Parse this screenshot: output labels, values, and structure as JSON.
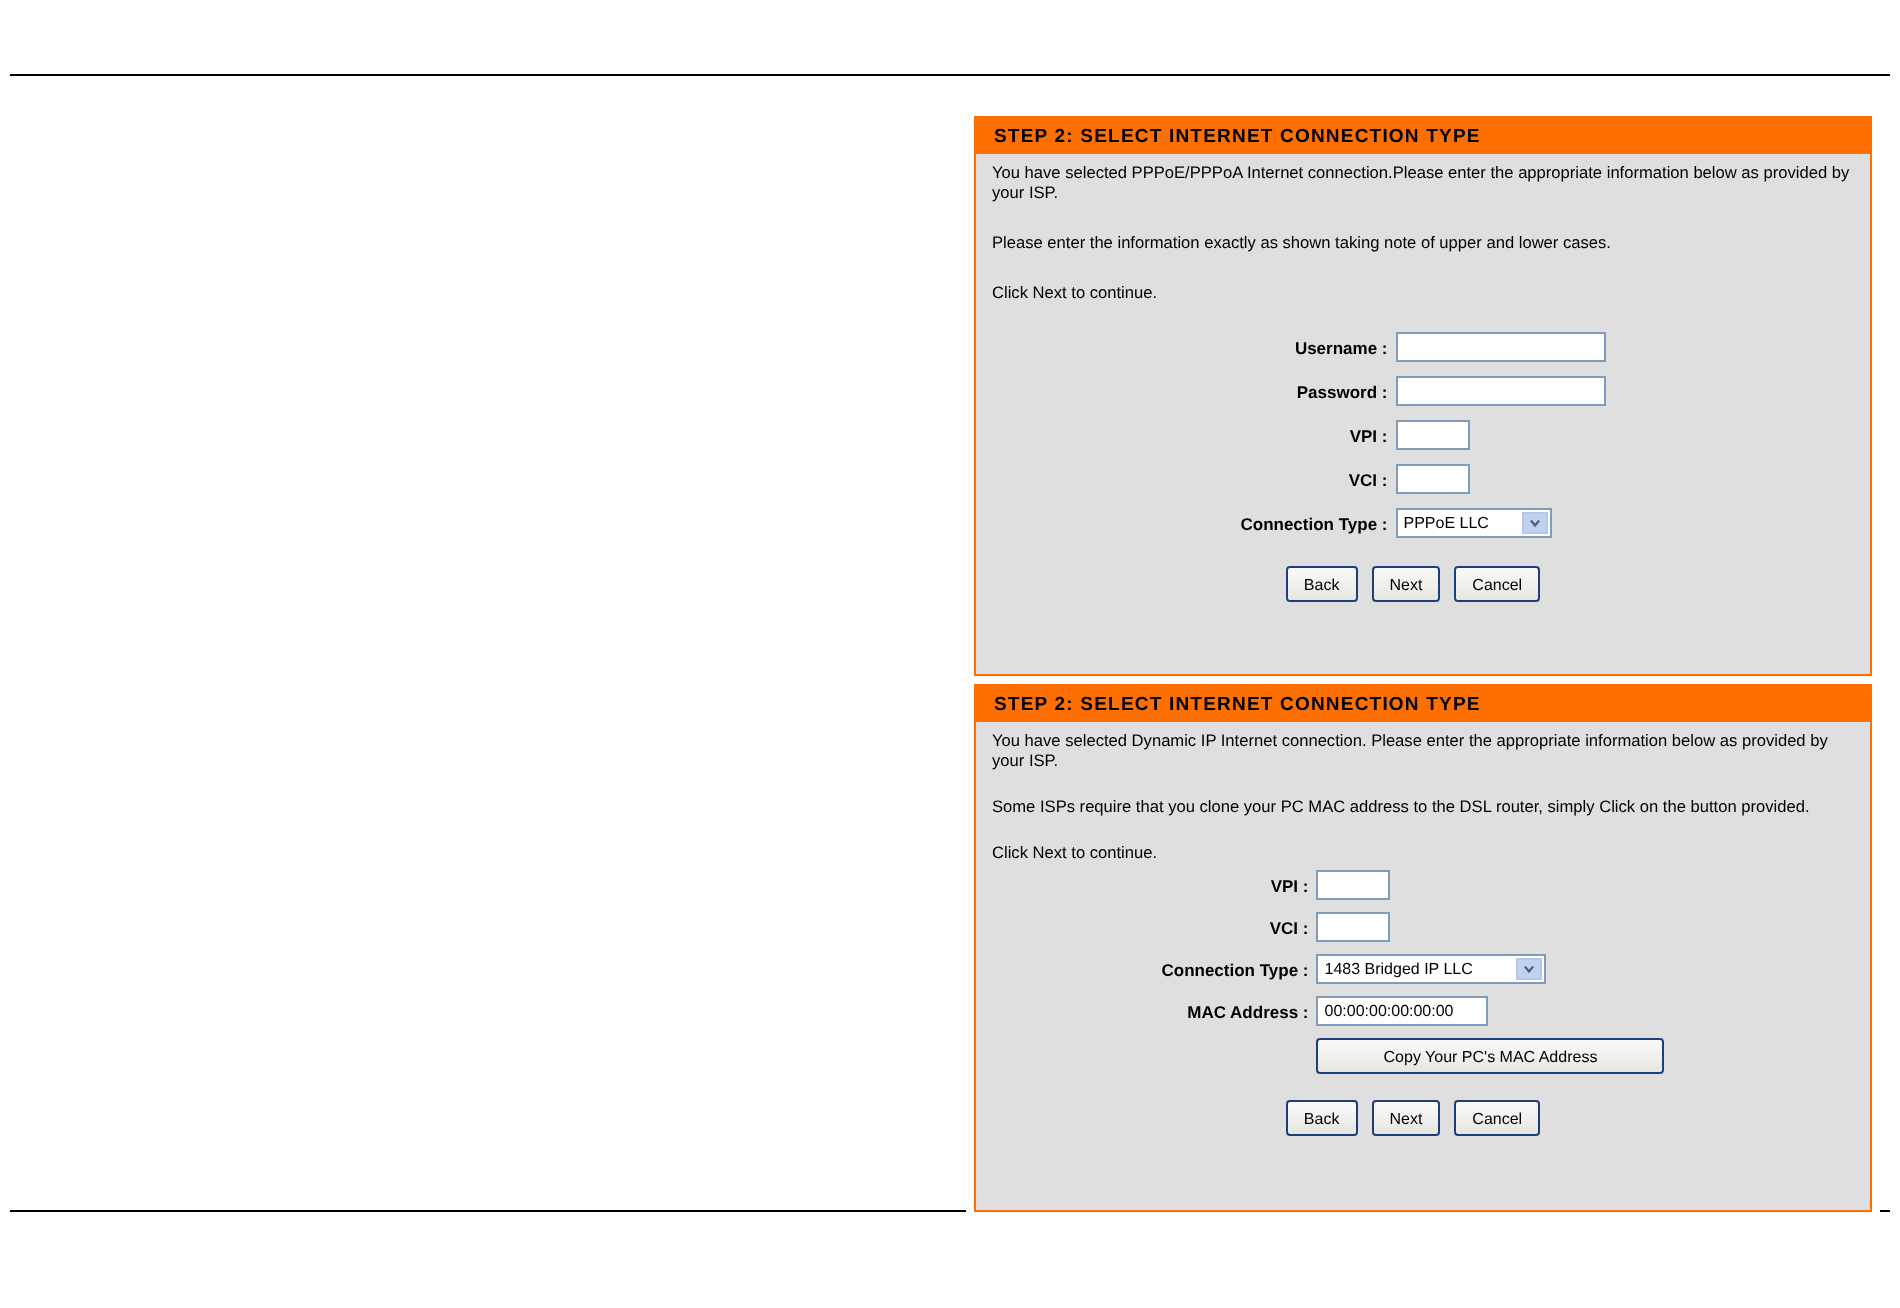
{
  "panels": [
    {
      "title": "STEP 2: SELECT INTERNET CONNECTION TYPE",
      "paragraphs": [
        "You have selected PPPoE/PPPoA Internet connection.Please enter the appropriate information below as provided by your ISP.",
        "Please enter the information exactly as shown taking note of upper and lower cases.",
        "Click Next to continue."
      ],
      "fields": [
        {
          "kind": "text",
          "label": "Username :"
        },
        {
          "kind": "text",
          "label": "Password :"
        },
        {
          "kind": "short",
          "label": "VPI :"
        },
        {
          "kind": "short",
          "label": "VCI :"
        },
        {
          "kind": "select",
          "label": "Connection Type :",
          "value": "PPPoE LLC"
        }
      ],
      "buttons": [
        "Back",
        "Next",
        "Cancel"
      ]
    },
    {
      "title": "STEP 2: SELECT INTERNET CONNECTION TYPE",
      "paragraphs": [
        "You have selected Dynamic IP Internet connection. Please enter the appropriate information below as provided by your ISP.",
        "Some ISPs require that you clone your PC MAC address to the DSL router, simply Click on the button provided.",
        "Click Next to continue."
      ],
      "fields": [
        {
          "kind": "short",
          "label": "VPI :"
        },
        {
          "kind": "short",
          "label": "VCI :"
        },
        {
          "kind": "wide-select",
          "label": "Connection Type :",
          "value": "1483 Bridged IP LLC"
        },
        {
          "kind": "mac",
          "label": "MAC Address :",
          "value": "00:00:00:00:00:00"
        },
        {
          "kind": "action",
          "value": "Copy Your PC's MAC Address"
        }
      ],
      "buttons": [
        "Back",
        "Next",
        "Cancel"
      ]
    }
  ]
}
